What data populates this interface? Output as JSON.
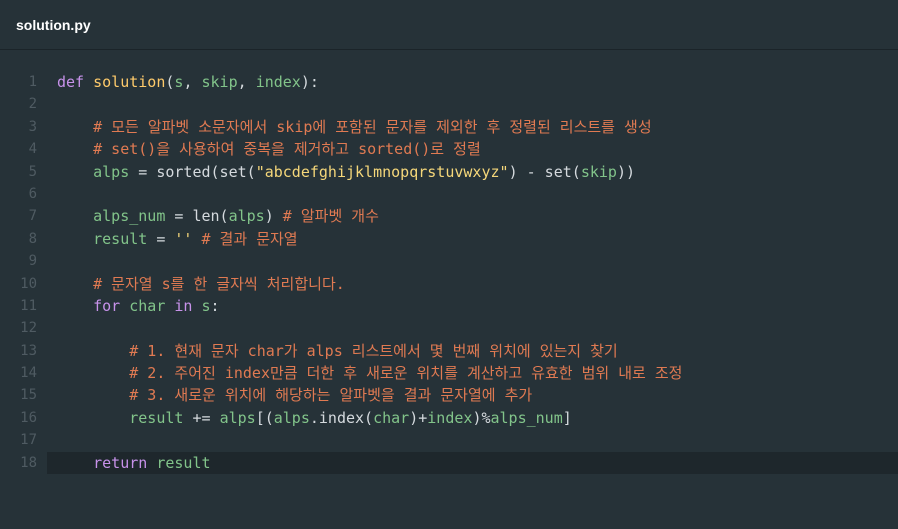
{
  "window": {
    "title": "solution.py"
  },
  "lines": [
    {
      "n": "1",
      "tokens": [
        {
          "t": "def",
          "c": "kw"
        },
        {
          "t": " ",
          "c": "pl"
        },
        {
          "t": "solution",
          "c": "fn"
        },
        {
          "t": "(",
          "c": "pl"
        },
        {
          "t": "s",
          "c": "id"
        },
        {
          "t": ", ",
          "c": "pl"
        },
        {
          "t": "skip",
          "c": "id"
        },
        {
          "t": ", ",
          "c": "pl"
        },
        {
          "t": "index",
          "c": "id"
        },
        {
          "t": "):",
          "c": "pl"
        }
      ]
    },
    {
      "n": "2",
      "tokens": []
    },
    {
      "n": "3",
      "tokens": [
        {
          "t": "    # 모든 알파벳 소문자에서 skip에 포함된 문자를 제외한 후 정렬된 리스트를 생성",
          "c": "cm"
        }
      ]
    },
    {
      "n": "4",
      "tokens": [
        {
          "t": "    # set()을 사용하여 중복을 제거하고 sorted()로 정렬",
          "c": "cm"
        }
      ]
    },
    {
      "n": "5",
      "tokens": [
        {
          "t": "    alps",
          "c": "id"
        },
        {
          "t": " = sorted(set(",
          "c": "pl"
        },
        {
          "t": "\"abcdefghijklmnopqrstuvwxyz\"",
          "c": "st"
        },
        {
          "t": ") - set(",
          "c": "pl"
        },
        {
          "t": "skip",
          "c": "id"
        },
        {
          "t": "))",
          "c": "pl"
        }
      ]
    },
    {
      "n": "6",
      "tokens": []
    },
    {
      "n": "7",
      "tokens": [
        {
          "t": "    alps_num",
          "c": "id"
        },
        {
          "t": " = len(",
          "c": "pl"
        },
        {
          "t": "alps",
          "c": "id"
        },
        {
          "t": ") ",
          "c": "pl"
        },
        {
          "t": "# 알파벳 개수",
          "c": "cm"
        }
      ]
    },
    {
      "n": "8",
      "tokens": [
        {
          "t": "    result",
          "c": "id"
        },
        {
          "t": " = ",
          "c": "pl"
        },
        {
          "t": "''",
          "c": "st"
        },
        {
          "t": " ",
          "c": "pl"
        },
        {
          "t": "# 결과 문자열",
          "c": "cm"
        }
      ]
    },
    {
      "n": "9",
      "tokens": []
    },
    {
      "n": "10",
      "tokens": [
        {
          "t": "    # 문자열 s를 한 글자씩 처리합니다.",
          "c": "cm"
        }
      ]
    },
    {
      "n": "11",
      "tokens": [
        {
          "t": "    ",
          "c": "pl"
        },
        {
          "t": "for",
          "c": "kw"
        },
        {
          "t": " char ",
          "c": "id"
        },
        {
          "t": "in",
          "c": "kw"
        },
        {
          "t": " s",
          "c": "id"
        },
        {
          "t": ":",
          "c": "pl"
        }
      ]
    },
    {
      "n": "12",
      "tokens": []
    },
    {
      "n": "13",
      "tokens": [
        {
          "t": "        # 1. 현재 문자 char가 alps 리스트에서 몇 번째 위치에 있는지 찾기",
          "c": "cm"
        }
      ]
    },
    {
      "n": "14",
      "tokens": [
        {
          "t": "        # 2. 주어진 index만큼 더한 후 새로운 위치를 계산하고 유효한 범위 내로 조정",
          "c": "cm"
        }
      ]
    },
    {
      "n": "15",
      "tokens": [
        {
          "t": "        # 3. 새로운 위치에 해당하는 알파벳을 결과 문자열에 추가",
          "c": "cm"
        }
      ]
    },
    {
      "n": "16",
      "tokens": [
        {
          "t": "        result",
          "c": "id"
        },
        {
          "t": " += ",
          "c": "pl"
        },
        {
          "t": "alps",
          "c": "id"
        },
        {
          "t": "[(",
          "c": "pl"
        },
        {
          "t": "alps",
          "c": "id"
        },
        {
          "t": ".index(",
          "c": "pl"
        },
        {
          "t": "char",
          "c": "id"
        },
        {
          "t": ")+",
          "c": "pl"
        },
        {
          "t": "index",
          "c": "id"
        },
        {
          "t": ")%",
          "c": "pl"
        },
        {
          "t": "alps_num",
          "c": "id"
        },
        {
          "t": "]",
          "c": "pl"
        }
      ]
    },
    {
      "n": "17",
      "tokens": []
    },
    {
      "n": "18",
      "active": true,
      "tokens": [
        {
          "t": "    ",
          "c": "pl"
        },
        {
          "t": "return",
          "c": "kw"
        },
        {
          "t": " result",
          "c": "id"
        }
      ]
    }
  ]
}
